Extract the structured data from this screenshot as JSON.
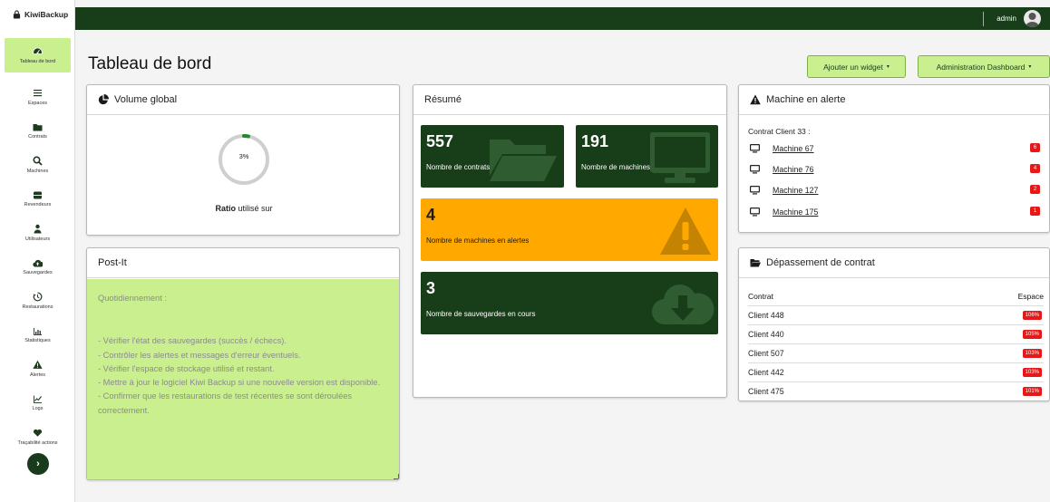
{
  "brand": {
    "name": "KiwiBackup"
  },
  "sidebar": {
    "items": [
      {
        "label": "Tableau de bord",
        "icon": "dashboard-icon"
      },
      {
        "label": "Espaces",
        "icon": "list-icon"
      },
      {
        "label": "Contrats",
        "icon": "folder-icon"
      },
      {
        "label": "Machines",
        "icon": "search-icon"
      },
      {
        "label": "Revendeurs",
        "icon": "database-icon"
      },
      {
        "label": "Utilisateurs",
        "icon": "user-icon"
      },
      {
        "label": "Sauvegardes",
        "icon": "cloud-upload-icon"
      },
      {
        "label": "Restaurations",
        "icon": "history-icon"
      },
      {
        "label": "Statistiques",
        "icon": "bar-chart-icon"
      },
      {
        "label": "Alertes",
        "icon": "warning-icon"
      },
      {
        "label": "Logs",
        "icon": "line-chart-icon"
      },
      {
        "label": "Traçabilité actions",
        "icon": "heart-icon"
      }
    ],
    "toggle": "›"
  },
  "topbar": {
    "user": "admin"
  },
  "header": {
    "title": "Tableau de bord",
    "add_widget": "Ajouter un widget",
    "admin_dashboard": "Administration Dashboard",
    "caret": "▾"
  },
  "volume": {
    "title": "Volume global",
    "percent_label": "3%",
    "percent_value": 3,
    "ratio_bold": "Ratio",
    "ratio_rest": " utilisé sur"
  },
  "postit": {
    "title": "Post-It",
    "intro": "Quotidiennement :",
    "lines": [
      "- Vérifier l'état des sauvegardes (succès / échecs).",
      "- Contrôler les alertes et messages d'erreur éventuels.",
      "- Vérifier l'espace de stockage utilisé et restant.",
      "- Mettre à jour le logiciel Kiwi Backup si une nouvelle version est disponible.",
      "- Confirmer que les restaurations de test récentes se sont déroulées correctement."
    ]
  },
  "resume": {
    "title": "Résumé",
    "contrats": {
      "value": "557",
      "label": "Nombre de contrats"
    },
    "machines": {
      "value": "191",
      "label": "Nombre de machines"
    },
    "alertes": {
      "value": "4",
      "label": "Nombre de machines en alertes"
    },
    "sauvegardes": {
      "value": "3",
      "label": "Nombre de sauvegardes en cours"
    }
  },
  "alert_panel": {
    "title": "Machine en alerte",
    "client": "Contrat Client 33 :",
    "machines": [
      {
        "name": "Machine 67",
        "badge": "6"
      },
      {
        "name": "Machine 76",
        "badge": "4"
      },
      {
        "name": "Machine 127",
        "badge": "2"
      },
      {
        "name": "Machine 175",
        "badge": "1"
      }
    ]
  },
  "depassement": {
    "title": "Dépassement de contrat",
    "col_contrat": "Contrat",
    "col_espace": "Espace",
    "rows": [
      {
        "client": "Client 448",
        "espace": "106%"
      },
      {
        "client": "Client 440",
        "espace": "105%"
      },
      {
        "client": "Client 507",
        "espace": "103%"
      },
      {
        "client": "Client 442",
        "espace": "103%"
      },
      {
        "client": "Client 475",
        "espace": "101%"
      }
    ]
  },
  "colors": {
    "dark_green": "#173d19",
    "light_green": "#c9ef8f",
    "orange": "#ffa800",
    "alert_red": "#e71818"
  }
}
